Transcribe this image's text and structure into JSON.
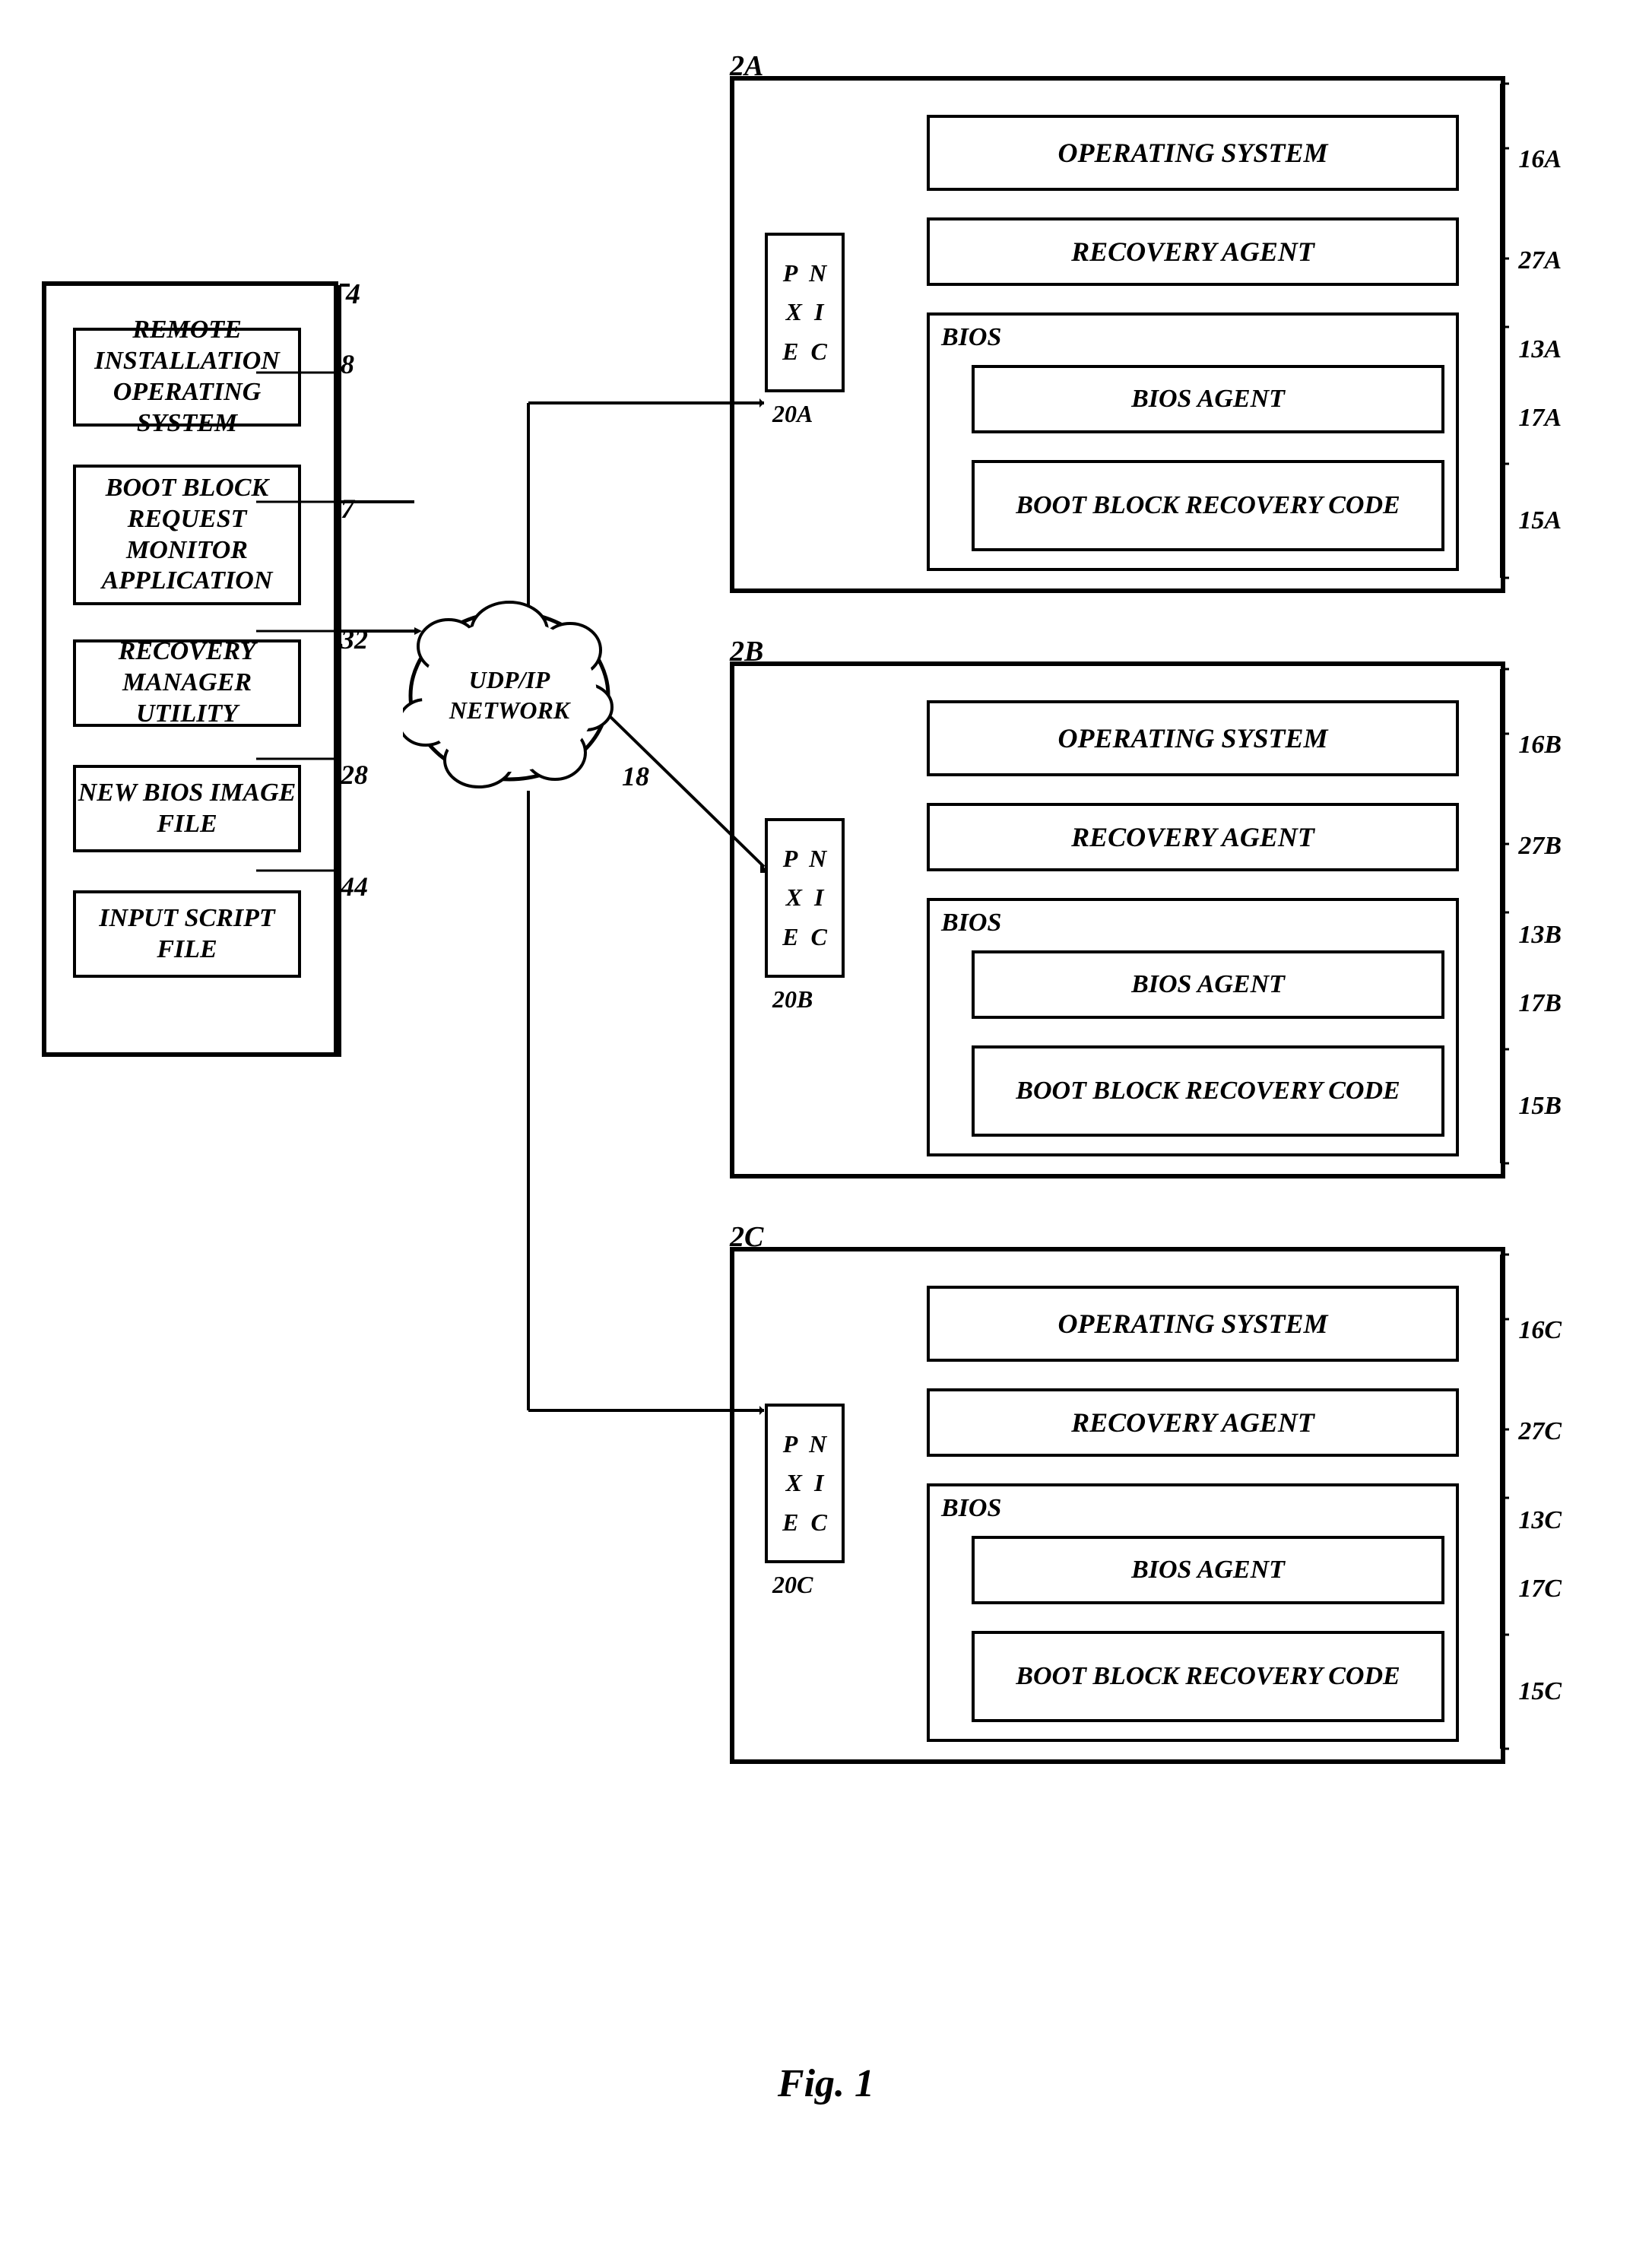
{
  "figure": {
    "caption": "Fig. 1"
  },
  "left_server": {
    "ref": "4",
    "boxes": {
      "remote_os": "REMOTE INSTALLATION OPERATING SYSTEM",
      "bootblock_monitor": "BOOT BLOCK REQUEST MONITOR APPLICATION",
      "recovery_mgr": "RECOVERY MANAGER UTILITY",
      "new_bios": "NEW BIOS IMAGE FILE",
      "input_script": "INPUT SCRIPT FILE"
    },
    "refs": {
      "r8": "8",
      "r7": "7",
      "r32": "32",
      "r28": "28",
      "r44": "44"
    }
  },
  "network": {
    "label_line1": "UDP/IP",
    "label_line2": "NETWORK",
    "ref": "18"
  },
  "client_a": {
    "ref": "2A",
    "pxe_label": "P\nN\nX\nI\nE\nC",
    "pxe_ref": "20A",
    "boxes": {
      "os": "OPERATING SYSTEM",
      "recovery": "RECOVERY AGENT",
      "bios": "BIOS",
      "bios_agent": "BIOS AGENT",
      "bootblock": "BOOT BLOCK RECOVERY CODE"
    },
    "refs": {
      "r16": "16A",
      "r27": "27A",
      "r13": "13A",
      "r17": "17A",
      "r15": "15A"
    }
  },
  "client_b": {
    "ref": "2B",
    "pxe_label": "P\nN\nX\nI\nE\nC",
    "pxe_ref": "20B",
    "boxes": {
      "os": "OPERATING SYSTEM",
      "recovery": "RECOVERY AGENT",
      "bios": "BIOS",
      "bios_agent": "BIOS AGENT",
      "bootblock": "BOOT BLOCK RECOVERY CODE"
    },
    "refs": {
      "r16": "16B",
      "r27": "27B",
      "r13": "13B",
      "r17": "17B",
      "r15": "15B"
    }
  },
  "client_c": {
    "ref": "2C",
    "pxe_label": "P\nN\nX\nI\nE\nC",
    "pxe_ref": "20C",
    "boxes": {
      "os": "OPERATING SYSTEM",
      "recovery": "RECOVERY AGENT",
      "bios": "BIOS",
      "bios_agent": "BIOS AGENT",
      "bootblock": "BOOT BLOCK RECOVERY CODE"
    },
    "refs": {
      "r16": "16C",
      "r27": "27C",
      "r13": "13C",
      "r17": "17C",
      "r15": "15C"
    }
  }
}
